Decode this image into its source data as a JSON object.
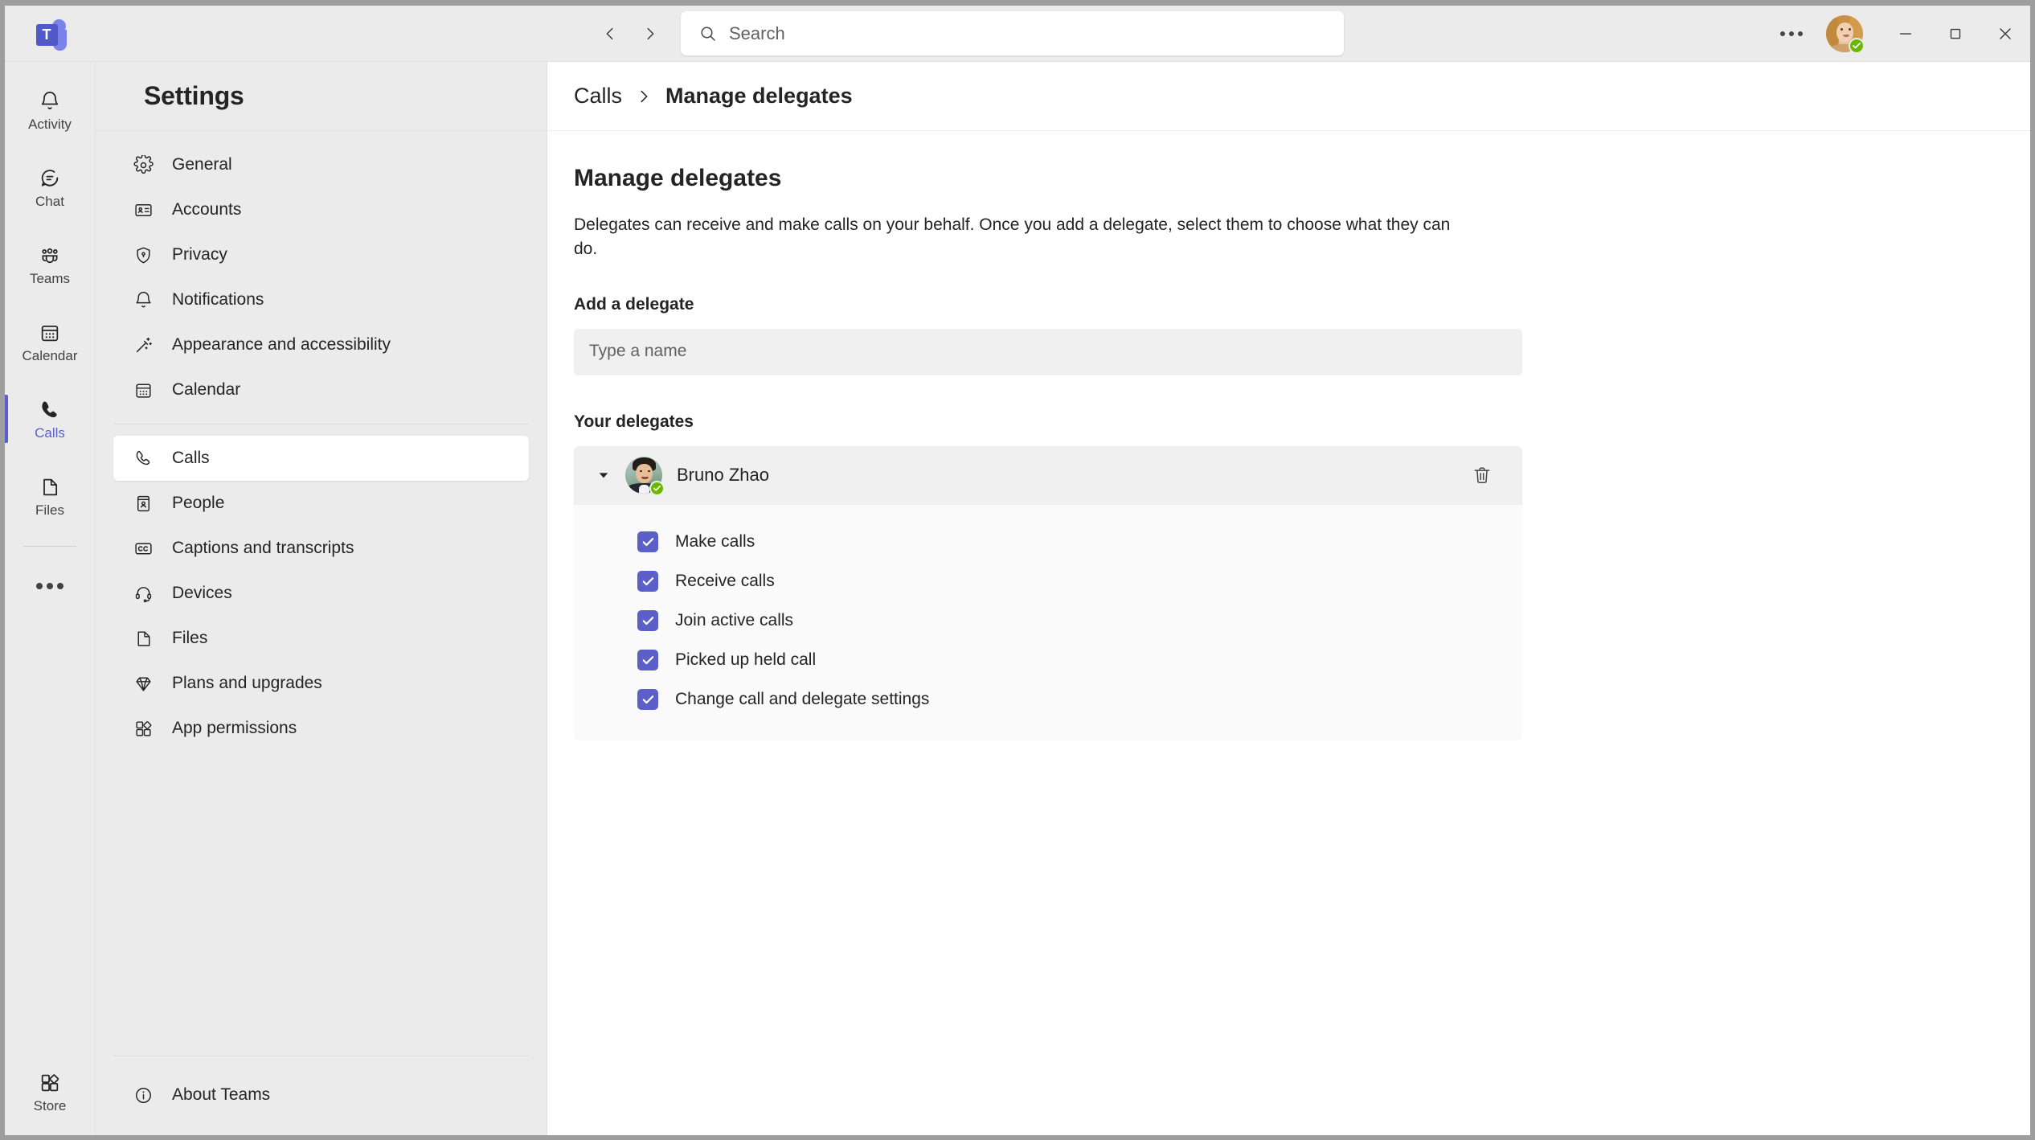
{
  "window": {
    "app_logo_letter": "T",
    "minimize_label": "Minimize",
    "maximize_label": "Maximize",
    "close_label": "Close",
    "more_options_label": "Settings and more",
    "back_label": "Go back",
    "forward_label": "Go forward"
  },
  "search": {
    "placeholder": "Search",
    "value": ""
  },
  "user": {
    "presence": "Available",
    "presence_color": "#6BB700"
  },
  "rail": {
    "items": [
      {
        "label": "Activity",
        "icon": "bell-icon",
        "active": false
      },
      {
        "label": "Chat",
        "icon": "chat-icon",
        "active": false
      },
      {
        "label": "Teams",
        "icon": "teams-icon",
        "active": false
      },
      {
        "label": "Calendar",
        "icon": "calendar-icon",
        "active": false
      },
      {
        "label": "Calls",
        "icon": "phone-icon",
        "active": true
      },
      {
        "label": "Files",
        "icon": "file-icon",
        "active": false
      }
    ],
    "more_label": "More apps",
    "store": {
      "label": "Store",
      "icon": "store-icon"
    }
  },
  "settings": {
    "title": "Settings",
    "items": [
      {
        "label": "General",
        "icon": "gear-icon",
        "active": false
      },
      {
        "label": "Accounts",
        "icon": "id-card-icon",
        "active": false
      },
      {
        "label": "Privacy",
        "icon": "shield-lock-icon",
        "active": false
      },
      {
        "label": "Notifications",
        "icon": "bell-icon",
        "active": false
      },
      {
        "label": "Appearance and accessibility",
        "icon": "magic-wand-icon",
        "active": false
      },
      {
        "label": "Calendar",
        "icon": "calendar-icon",
        "active": false
      }
    ],
    "items_group2": [
      {
        "label": "Calls",
        "icon": "phone-icon",
        "active": true
      },
      {
        "label": "People",
        "icon": "people-book-icon",
        "active": false
      },
      {
        "label": "Captions and transcripts",
        "icon": "cc-icon",
        "active": false
      },
      {
        "label": "Devices",
        "icon": "headset-icon",
        "active": false
      },
      {
        "label": "Files",
        "icon": "file-icon",
        "active": false
      },
      {
        "label": "Plans and upgrades",
        "icon": "diamond-icon",
        "active": false
      },
      {
        "label": "App permissions",
        "icon": "apps-icon",
        "active": false
      }
    ],
    "about": {
      "label": "About Teams",
      "icon": "info-icon"
    }
  },
  "breadcrumb": {
    "parent": "Calls",
    "separator": "chevron-right-icon",
    "current": "Manage delegates"
  },
  "main": {
    "title": "Manage delegates",
    "description": "Delegates can receive and make calls on your behalf. Once you add a delegate, select them to choose what they can do.",
    "add_section_label": "Add a delegate",
    "add_input_placeholder": "Type a name",
    "add_input_value": "",
    "delegates_section_label": "Your delegates",
    "delegate": {
      "name": "Bruno Zhao",
      "presence": "Available",
      "expanded": true,
      "delete_label": "Remove delegate",
      "permissions": [
        {
          "label": "Make calls",
          "checked": true
        },
        {
          "label": "Receive calls",
          "checked": true
        },
        {
          "label": "Join active calls",
          "checked": true
        },
        {
          "label": "Picked up held call",
          "checked": true
        },
        {
          "label": "Change call and delegate settings",
          "checked": true
        }
      ]
    }
  },
  "theme": {
    "accent": "#5B5FC7",
    "brand_dark": "#5059C9",
    "brand_light": "#7B83EB",
    "presence_green": "#6BB700",
    "text": "#242424",
    "panel_bg": "#EBEBEB",
    "content_bg": "#FFFFFF"
  }
}
